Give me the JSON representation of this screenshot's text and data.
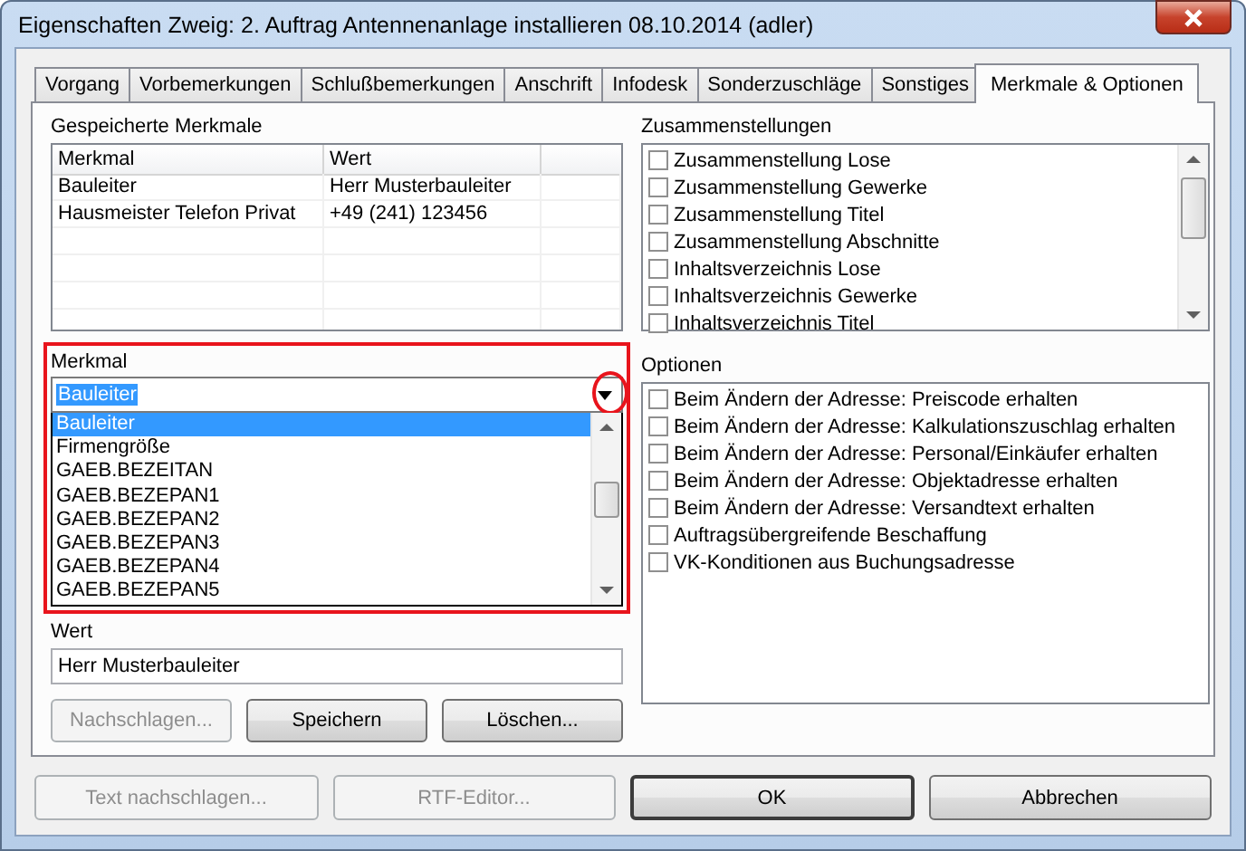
{
  "window": {
    "title": "Eigenschaften Zweig: 2. Auftrag Antennenanlage installieren 08.10.2014 (adler)"
  },
  "tabs": [
    {
      "label": "Vorgang",
      "selected": false
    },
    {
      "label": "Vorbemerkungen",
      "selected": false
    },
    {
      "label": "Schlußbemerkungen",
      "selected": false
    },
    {
      "label": "Anschrift",
      "selected": false
    },
    {
      "label": "Infodesk",
      "selected": false
    },
    {
      "label": "Sonderzuschläge",
      "selected": false
    },
    {
      "label": "Sonstiges",
      "selected": false
    },
    {
      "label": "Merkmale & Optionen",
      "selected": true
    }
  ],
  "saved_features": {
    "label": "Gespeicherte Merkmale",
    "columns": [
      "Merkmal",
      "Wert"
    ],
    "rows": [
      {
        "merkmal": "Bauleiter",
        "wert": "Herr Musterbauleiter"
      },
      {
        "merkmal": "Hausmeister Telefon Privat",
        "wert": "+49 (241) 123456"
      }
    ]
  },
  "feature": {
    "label": "Merkmal",
    "value": "Bauleiter",
    "options": [
      {
        "label": "Bauleiter",
        "selected": true
      },
      {
        "label": "Firmengröße",
        "selected": false
      },
      {
        "label": "GAEB.BEZEITAN",
        "selected": false
      },
      {
        "label": "GAEB.BEZEPAN1",
        "selected": false
      },
      {
        "label": "GAEB.BEZEPAN2",
        "selected": false
      },
      {
        "label": "GAEB.BEZEPAN3",
        "selected": false
      },
      {
        "label": "GAEB.BEZEPAN4",
        "selected": false
      },
      {
        "label": "GAEB.BEZEPAN5",
        "selected": false
      }
    ]
  },
  "value_field": {
    "label": "Wert",
    "value": "Herr Musterbauleiter"
  },
  "feature_buttons": [
    {
      "label": "Nachschlagen...",
      "disabled": true
    },
    {
      "label": "Speichern",
      "disabled": false
    },
    {
      "label": "Löschen...",
      "disabled": false
    }
  ],
  "compilations": {
    "label": "Zusammenstellungen",
    "items": [
      {
        "label": "Zusammenstellung Lose",
        "checked": false
      },
      {
        "label": "Zusammenstellung Gewerke",
        "checked": false
      },
      {
        "label": "Zusammenstellung Titel",
        "checked": false
      },
      {
        "label": "Zusammenstellung Abschnitte",
        "checked": false
      },
      {
        "label": "Inhaltsverzeichnis Lose",
        "checked": false
      },
      {
        "label": "Inhaltsverzeichnis Gewerke",
        "checked": false
      },
      {
        "label": "Inhaltsverzeichnis Titel",
        "checked": false
      }
    ]
  },
  "options": {
    "label": "Optionen",
    "items": [
      {
        "label": "Beim Ändern der Adresse: Preiscode erhalten",
        "checked": false
      },
      {
        "label": "Beim Ändern der Adresse: Kalkulationszuschlag erhalten",
        "checked": false
      },
      {
        "label": "Beim Ändern der Adresse: Personal/Einkäufer erhalten",
        "checked": false
      },
      {
        "label": "Beim Ändern der Adresse: Objektadresse erhalten",
        "checked": false
      },
      {
        "label": "Beim Ändern der Adresse: Versandtext erhalten",
        "checked": false
      },
      {
        "label": "Auftragsübergreifende Beschaffung",
        "checked": false
      },
      {
        "label": "VK-Konditionen aus Buchungsadresse",
        "checked": false
      }
    ]
  },
  "dialog_buttons": [
    {
      "label": "Text nachschlagen...",
      "disabled": true,
      "default": false
    },
    {
      "label": "RTF-Editor...",
      "disabled": true,
      "default": false
    },
    {
      "label": "OK",
      "disabled": false,
      "default": true
    },
    {
      "label": "Abbrechen",
      "disabled": false,
      "default": false
    }
  ]
}
